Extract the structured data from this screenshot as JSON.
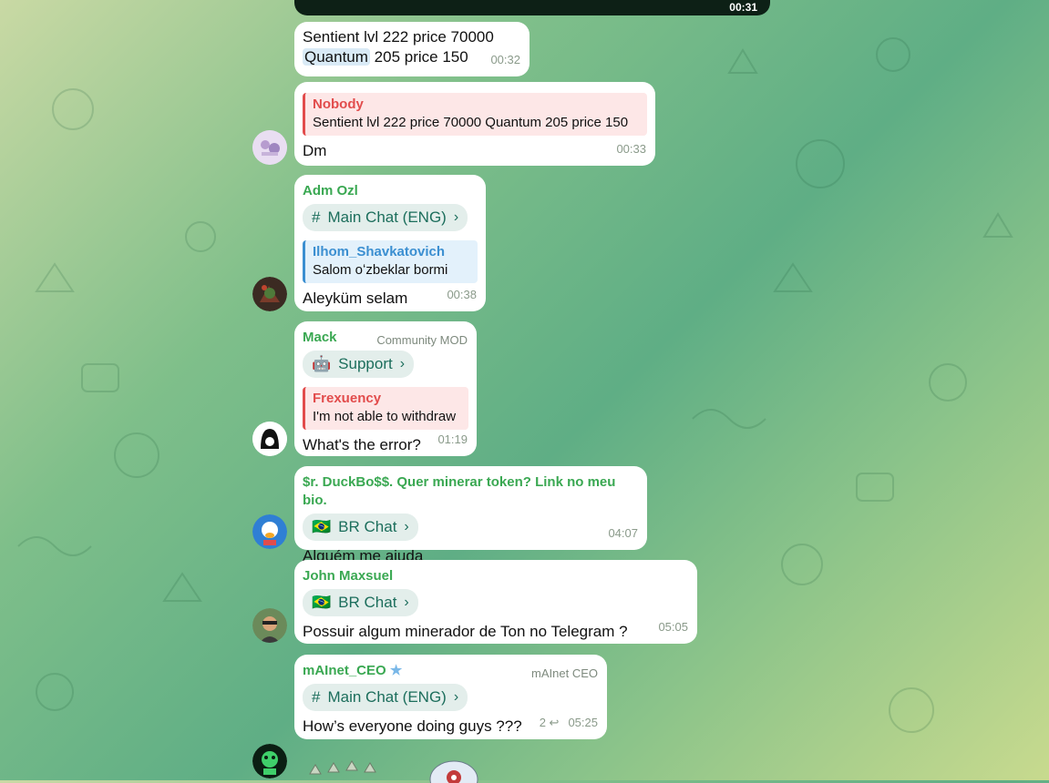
{
  "media": {
    "time": "00:31"
  },
  "messages": [
    {
      "text_part1": "Sentient lvl 222 price 70000",
      "highlight": "Quantum",
      "text_part2": " 205 price 150",
      "time": "00:32"
    },
    {
      "reply_name": "Nobody",
      "reply_text": "Sentient lvl 222 price 70000 Quantum 205 price 150",
      "text": "Dm",
      "time": "00:33"
    },
    {
      "sender": "Adm Ozl",
      "topic_icon": "#",
      "topic": "Main Chat (ENG)",
      "reply_name": "Ilhom_Shavkatovich",
      "reply_text": "Salom oʻzbeklar bormi",
      "text": "Aleyküm selam",
      "time": "00:38"
    },
    {
      "sender": "Mack",
      "role": "Community MOD",
      "topic_icon": "🤖",
      "topic": "Support",
      "reply_name": "Frexuency",
      "reply_text": "I'm not able to withdraw",
      "text": "What's the error?",
      "time": "01:19"
    },
    {
      "sender": "$r. DuckBo$$. Quer minerar token? Link no meu bio.",
      "topic_icon": "🇧🇷",
      "topic": "BR Chat",
      "text": "Alguém me ajuda",
      "time": "04:07"
    },
    {
      "sender": "John Maxsuel",
      "topic_icon": "🇧🇷",
      "topic": "BR Chat",
      "text": "Possuir algum minerador de Ton no Telegram ?",
      "time": "05:05"
    },
    {
      "sender": "mAInet_CEO",
      "role": "mAInet CEO",
      "topic_icon": "#",
      "topic": "Main Chat (ENG)",
      "text": "How’s everyone doing guys ???",
      "replies": "2",
      "time": "05:25"
    }
  ],
  "colors": {
    "sender": "#3aa852",
    "reply_red": "#e24c4c",
    "reply_blue": "#3b8fd1",
    "topic_text": "#1c6e5c"
  }
}
